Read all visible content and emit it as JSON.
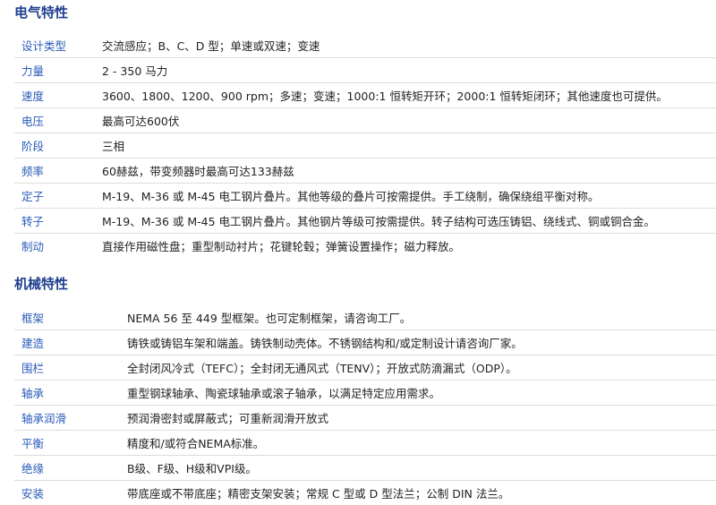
{
  "electrical": {
    "title": "电气特性",
    "rows": [
      {
        "label": "设计类型",
        "value": "交流感应；B、C、D 型；单速或双速；变速"
      },
      {
        "label": "力量",
        "value": "2 - 350 马力"
      },
      {
        "label": "速度",
        "value": "3600、1800、1200、900 rpm；多速；变速；1000:1 恒转矩开环；2000:1 恒转矩闭环；其他速度也可提供。"
      },
      {
        "label": "电压",
        "value": "最高可达600伏"
      },
      {
        "label": "阶段",
        "value": "三相"
      },
      {
        "label": "频率",
        "value": "60赫兹，带变频器时最高可达133赫兹"
      },
      {
        "label": "定子",
        "value": "M-19、M-36 或 M-45 电工钢片叠片。其他等级的叠片可按需提供。手工绕制，确保绕组平衡对称。"
      },
      {
        "label": "转子",
        "value": "M-19、M-36 或 M-45 电工钢片叠片。其他钢片等级可按需提供。转子结构可选压铸铝、绕线式、铜或铜合金。"
      },
      {
        "label": "制动",
        "value": "直接作用磁性盘；重型制动衬片；花键轮毂；弹簧设置操作；磁力释放。"
      }
    ]
  },
  "mechanical": {
    "title": "机械特性",
    "rows": [
      {
        "label": "框架",
        "value": "NEMA 56 至 449 型框架。也可定制框架，请咨询工厂。"
      },
      {
        "label": "建造",
        "value": "铸铁或铸铝车架和端盖。铸铁制动壳体。不锈钢结构和/或定制设计请咨询厂家。"
      },
      {
        "label": "围栏",
        "value": "全封闭风冷式（TEFC）；全封闭无通风式（TENV）；开放式防滴漏式（ODP）。"
      },
      {
        "label": "轴承",
        "value": "重型钢球轴承、陶瓷球轴承或滚子轴承，以满足特定应用需求。"
      },
      {
        "label": "轴承润滑",
        "value": "预润滑密封或屏蔽式；可重新润滑开放式"
      },
      {
        "label": "平衡",
        "value": "精度和/或符合NEMA标准。"
      },
      {
        "label": "绝缘",
        "value": "B级、F级、H级和VPI级。"
      },
      {
        "label": "安装",
        "value": "带底座或不带底座；精密支架安装；常规 C 型或 D 型法兰；公制 DIN 法兰。"
      }
    ]
  }
}
